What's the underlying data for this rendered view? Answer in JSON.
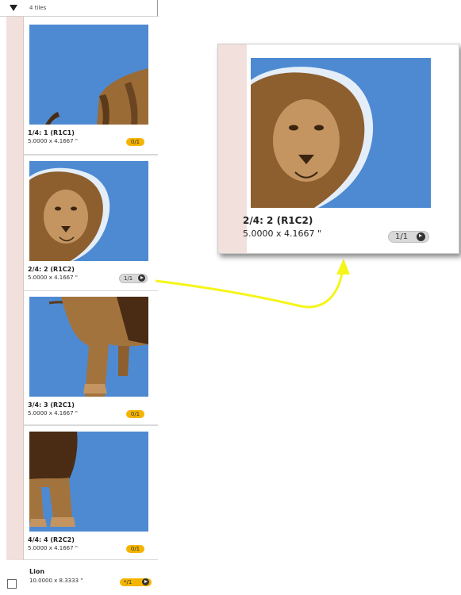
{
  "panel": {
    "header_label": "4 tiles",
    "tiles": [
      {
        "name": "1/4: 1 (R1C1)",
        "size": "5.0000 x 4.1667 \"",
        "badge": "0/1"
      },
      {
        "name": "2/4: 2 (R1C2)",
        "size": "5.0000 x 4.1667 \"",
        "badge": "1/1"
      },
      {
        "name": "3/4: 3 (R2C1)",
        "size": "5.0000 x 4.1667 \"",
        "badge": "0/1"
      },
      {
        "name": "4/4: 4 (R2C2)",
        "size": "5.0000 x 4.1667 \"",
        "badge": "0/1"
      }
    ],
    "document": {
      "name": "Lion",
      "size": "10.0000 x 8.3333 \"",
      "badge": "*/1"
    }
  },
  "zoom": {
    "name": "2/4: 2 (R1C2)",
    "size": "5.0000 x 4.1667 \"",
    "badge": "1/1"
  },
  "colors": {
    "sky": "#4e8ad2",
    "highlight_arrow": "#f5f51a",
    "badge_yellow": "#f4b400",
    "panel_strip": "#f2e0dc"
  }
}
